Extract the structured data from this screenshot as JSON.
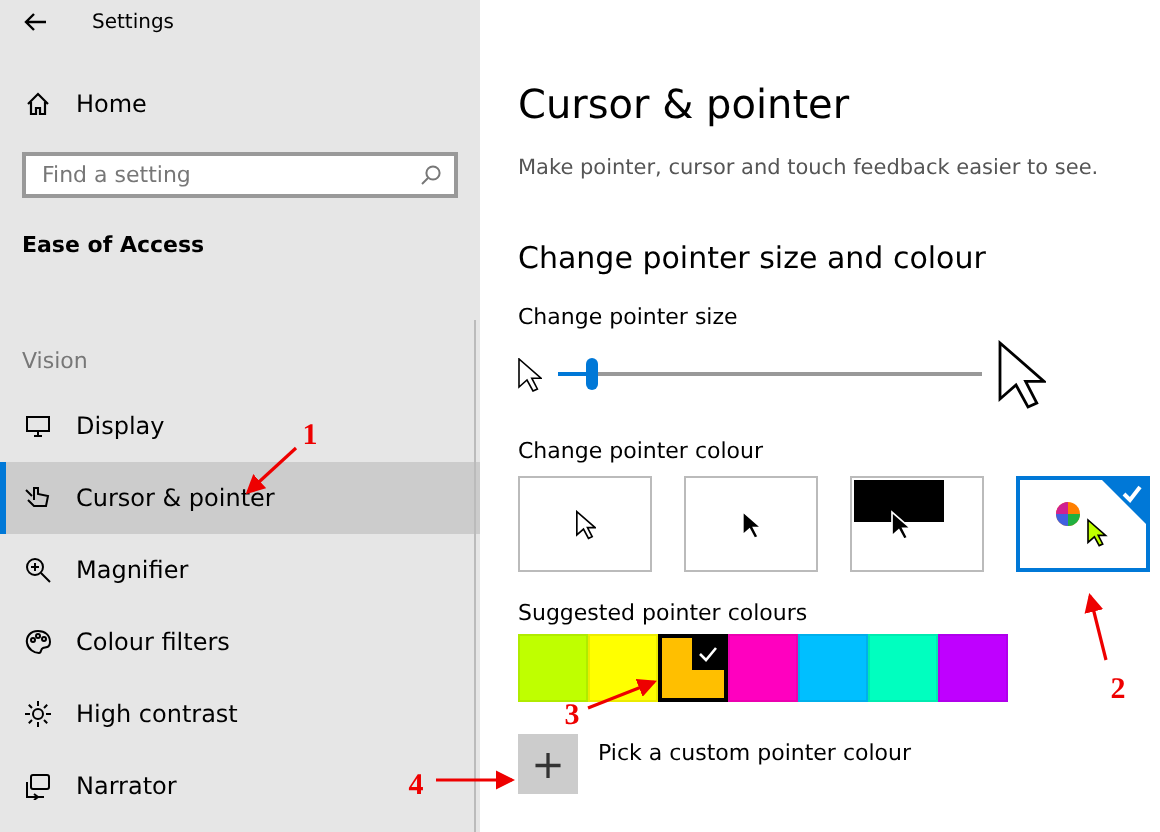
{
  "window": {
    "title": "Settings"
  },
  "sidebar": {
    "home": "Home",
    "search": {
      "placeholder": "Find a setting"
    },
    "category": "Ease of Access",
    "section": "Vision",
    "items": [
      {
        "label": "Display",
        "selected": false
      },
      {
        "label": "Cursor & pointer",
        "selected": true
      },
      {
        "label": "Magnifier",
        "selected": false
      },
      {
        "label": "Colour filters",
        "selected": false
      },
      {
        "label": "High contrast",
        "selected": false
      },
      {
        "label": "Narrator",
        "selected": false
      }
    ]
  },
  "page": {
    "title": "Cursor & pointer",
    "description": "Make pointer, cursor and touch feedback easier to see.",
    "heading": "Change pointer size and colour",
    "size_label": "Change pointer size",
    "size_slider": {
      "level": 0.08
    },
    "colour_label": "Change pointer colour",
    "colour_options": [
      {
        "kind": "white",
        "selected": false
      },
      {
        "kind": "black",
        "selected": false
      },
      {
        "kind": "inverted",
        "selected": false
      },
      {
        "kind": "custom",
        "selected": true
      }
    ],
    "suggested_label": "Suggested pointer colours",
    "suggested_colours": [
      {
        "color": "#bfff00",
        "selected": false
      },
      {
        "color": "#ffff00",
        "selected": false
      },
      {
        "color": "#ffbf00",
        "selected": true
      },
      {
        "color": "#ff00bf",
        "selected": false
      },
      {
        "color": "#00bfff",
        "selected": false
      },
      {
        "color": "#00ffbf",
        "selected": false
      },
      {
        "color": "#bf00ff",
        "selected": false
      }
    ],
    "custom_button": "+",
    "custom_label": "Pick a custom pointer colour"
  },
  "annotations": [
    {
      "number": "1"
    },
    {
      "number": "2"
    },
    {
      "number": "3"
    },
    {
      "number": "4"
    }
  ]
}
